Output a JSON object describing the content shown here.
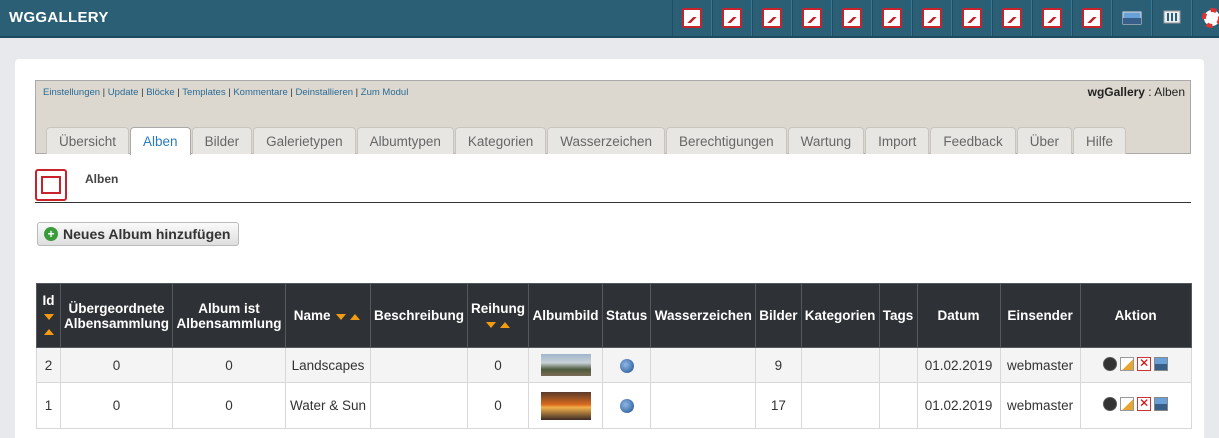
{
  "app": {
    "title": "WGGALLERY"
  },
  "toolbar_icons": [
    "dashboard-icon",
    "albums-icon",
    "images-icon",
    "gallery-types-icon",
    "album-types-icon",
    "categories-icon",
    "watermarks-icon",
    "permissions-icon",
    "maintenance-icon",
    "import-icon",
    "feedback-icon",
    "about-icon",
    "help-icon",
    "help-lifebuoy-icon"
  ],
  "admin": {
    "links": [
      "Einstellungen",
      "Update",
      "Blöcke",
      "Templates",
      "Kommentare",
      "Deinstallieren",
      "Zum Modul"
    ],
    "module_name": "wgGallery",
    "module_section": " : Alben",
    "tabs": [
      "Übersicht",
      "Alben",
      "Bilder",
      "Galerietypen",
      "Albumtypen",
      "Kategorien",
      "Wasserzeichen",
      "Berechtigungen",
      "Wartung",
      "Import",
      "Feedback",
      "Über",
      "Hilfe"
    ],
    "active_tab": "Alben"
  },
  "section": {
    "title": "Alben"
  },
  "add_button": {
    "label": "Neues Album hinzufügen"
  },
  "table": {
    "headers": {
      "id": "Id",
      "parent": "Übergeordnete Albensammlung",
      "is_collection": "Album ist Albensammlung",
      "name": "Name",
      "description": "Beschreibung",
      "weight": "Reihung",
      "image": "Albumbild",
      "status": "Status",
      "watermark": "Wasserzeichen",
      "images": "Bilder",
      "categories": "Kategorien",
      "tags": "Tags",
      "date": "Datum",
      "submitter": "Einsender",
      "actions": "Aktion"
    },
    "rows": [
      {
        "id": "2",
        "parent": "0",
        "is_collection": "0",
        "name": "Landscapes",
        "description": "",
        "weight": "0",
        "images": "9",
        "categories": "",
        "tags": "",
        "date": "01.02.2019",
        "submitter": "webmaster"
      },
      {
        "id": "1",
        "parent": "0",
        "is_collection": "0",
        "name": "Water & Sun",
        "description": "",
        "weight": "0",
        "images": "17",
        "categories": "",
        "tags": "",
        "date": "01.02.2019",
        "submitter": "webmaster"
      }
    ]
  },
  "colors": {
    "topbar": "#2b5f76",
    "accent_red": "#c8232c",
    "table_header": "#2e3135",
    "sort_arrow": "#f39c12",
    "active_tab": "#2b7bbf"
  }
}
